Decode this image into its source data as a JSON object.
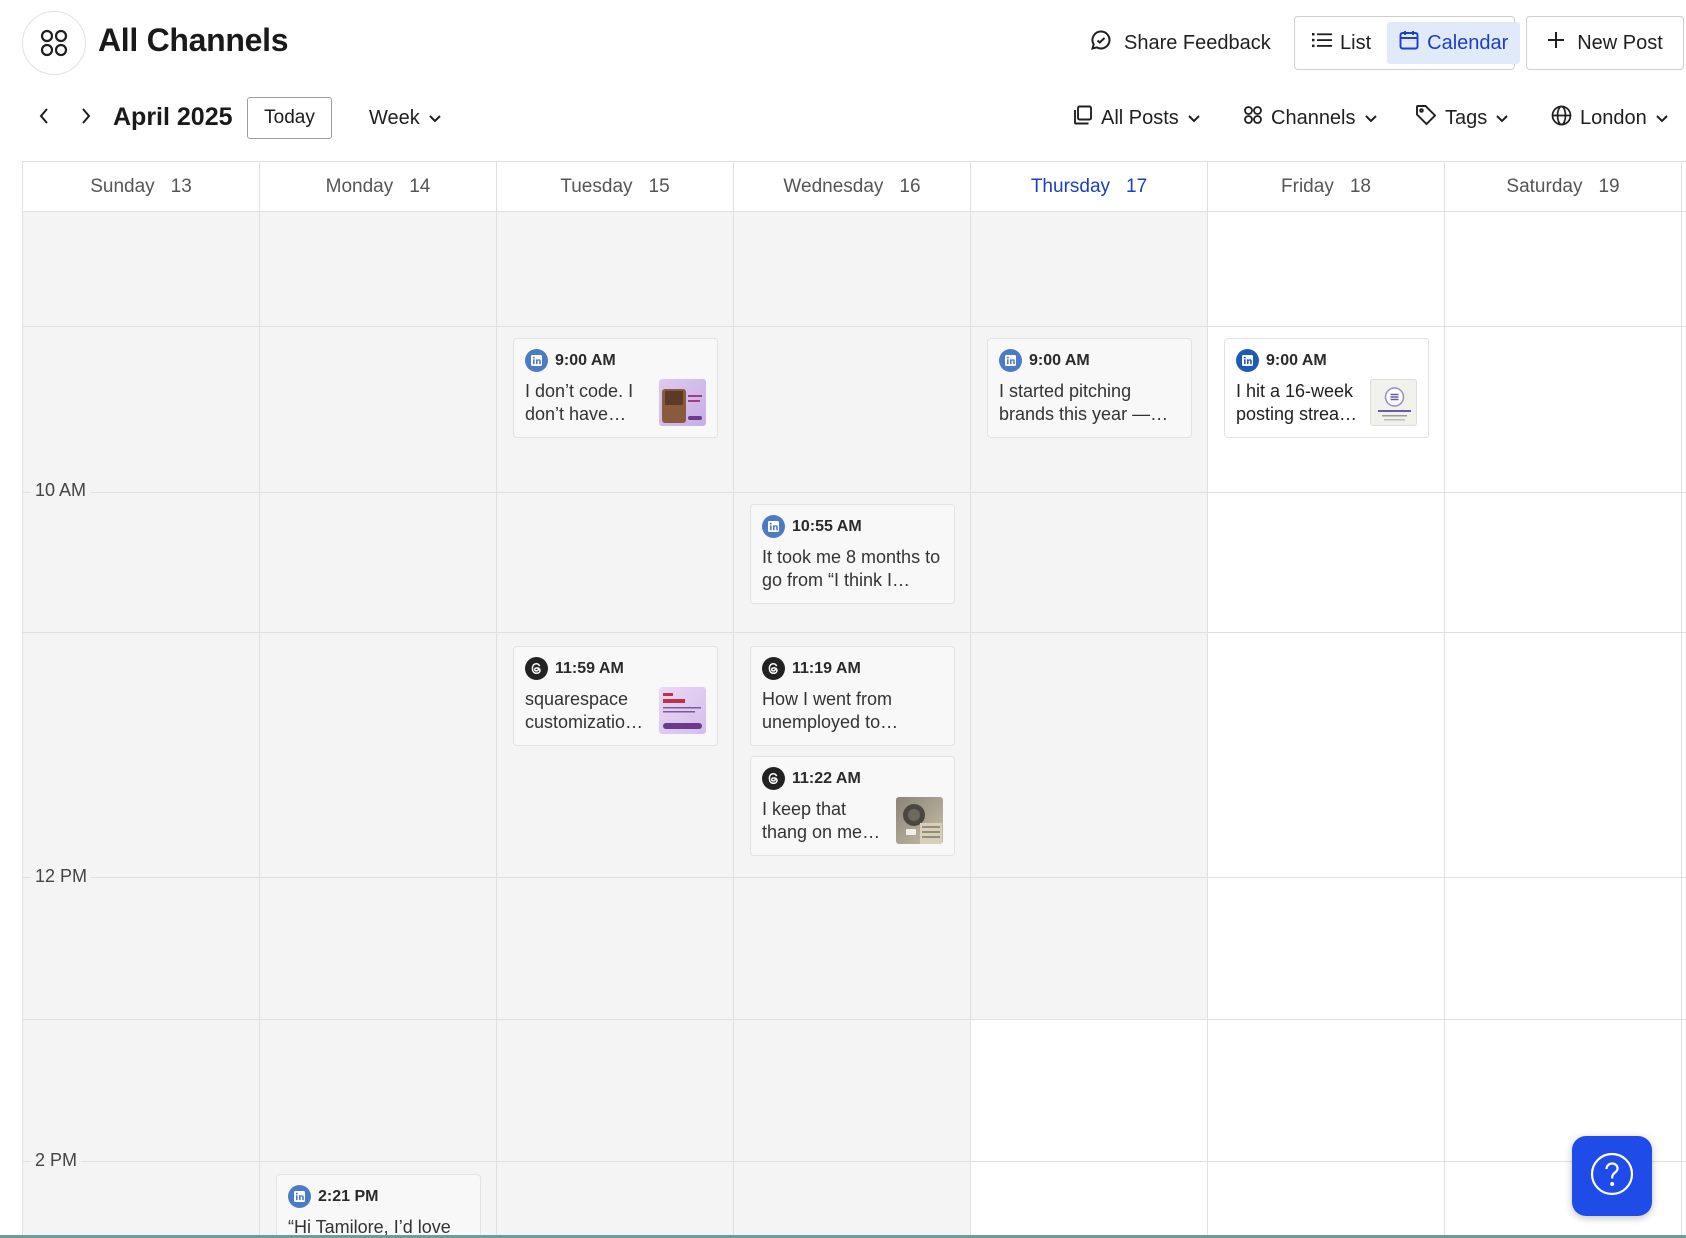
{
  "header": {
    "title": "All Channels",
    "feedback_label": "Share Feedback",
    "view_list_label": "List",
    "view_calendar_label": "Calendar",
    "new_post_label": "New Post"
  },
  "toolbar": {
    "month_label": "April 2025",
    "today_label": "Today",
    "range_label": "Week",
    "posts_filter_label": "All Posts",
    "channels_filter_label": "Channels",
    "tags_filter_label": "Tags",
    "timezone_label": "London"
  },
  "calendar": {
    "days": [
      {
        "name": "Sunday",
        "date": "13",
        "today": false
      },
      {
        "name": "Monday",
        "date": "14",
        "today": false
      },
      {
        "name": "Tuesday",
        "date": "15",
        "today": false
      },
      {
        "name": "Wednesday",
        "date": "16",
        "today": false
      },
      {
        "name": "Thursday",
        "date": "17",
        "today": true
      },
      {
        "name": "Friday",
        "date": "18",
        "today": false
      },
      {
        "name": "Saturday",
        "date": "19",
        "today": false
      }
    ],
    "time_labels": [
      "10 AM",
      "12 PM",
      "2 PM"
    ],
    "posts": [
      {
        "time": "9:00 AM",
        "network": "linkedin",
        "text": "I don’t code. I don’t have…",
        "thumb": "lavender"
      },
      {
        "time": "9:00 AM",
        "network": "linkedin",
        "text": "I started pitching brands this year —…",
        "thumb": ""
      },
      {
        "time": "9:00 AM",
        "network": "linkedin",
        "text": "I hit a 16-week posting strea…",
        "thumb": "streak"
      },
      {
        "time": "10:55 AM",
        "network": "linkedin",
        "text": "It took me 8 months to go from “I think I…",
        "thumb": ""
      },
      {
        "time": "11:59 AM",
        "network": "threads",
        "text": "squarespace customizatio…",
        "thumb": "lavender2"
      },
      {
        "time": "11:19 AM",
        "network": "threads",
        "text": "How I went from unemployed to…",
        "thumb": ""
      },
      {
        "time": "11:22 AM",
        "network": "threads",
        "text": "I keep that thang on me…",
        "thumb": "photo"
      },
      {
        "time": "2:21 PM",
        "network": "linkedin",
        "text": "“Hi Tamilore, I’d love",
        "thumb": ""
      }
    ]
  },
  "colors": {
    "accent": "#1a3fc4",
    "past_slot": "#f4f4f4",
    "linkedin_badge": "#4b7bc4",
    "threads_badge": "#222222",
    "help_button": "#1f4be8"
  }
}
